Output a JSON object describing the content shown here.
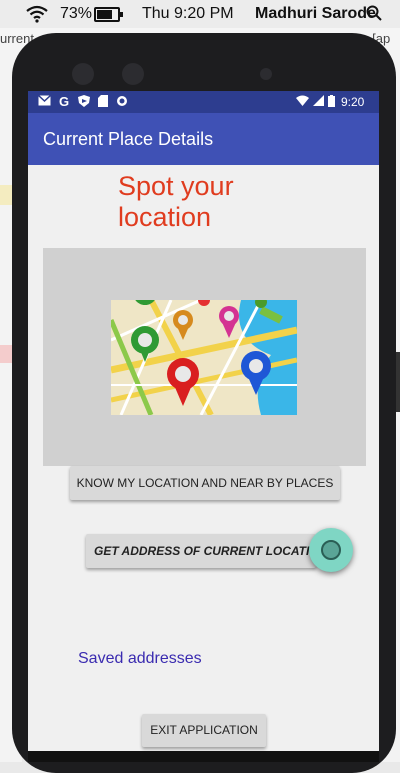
{
  "mac_menubar": {
    "battery_percent": "73%",
    "clock": "Thu 9:20 PM",
    "user": "Madhuri Sarode",
    "icons": [
      "wifi-icon",
      "battery-icon",
      "search-icon"
    ]
  },
  "ide_background": {
    "tab_fragment_left": "urrent",
    "tab_fragment_right": "s [ap"
  },
  "device_status": {
    "time": "9:20",
    "left_icons": [
      "gmail-icon",
      "google-icon",
      "shield-icon",
      "sdcard-icon",
      "sync-icon"
    ],
    "right_icons": [
      "wifi-icon",
      "signal-icon",
      "battery-icon"
    ]
  },
  "app": {
    "title": "Current Place Details",
    "heading": "Spot your location",
    "know_button": "KNOW MY LOCATION AND NEAR BY PLACES",
    "address_button": "GET ADDRESS OF CURRENT LOCATION",
    "saved_link": "Saved addresses",
    "exit_button": "EXIT APPLICATION"
  },
  "colors": {
    "app_bar": "#3f51b5",
    "status_bar": "#2d3d8f",
    "heading": "#e03c1f",
    "link": "#3a2bb0",
    "fab": "#7fd6c4"
  }
}
